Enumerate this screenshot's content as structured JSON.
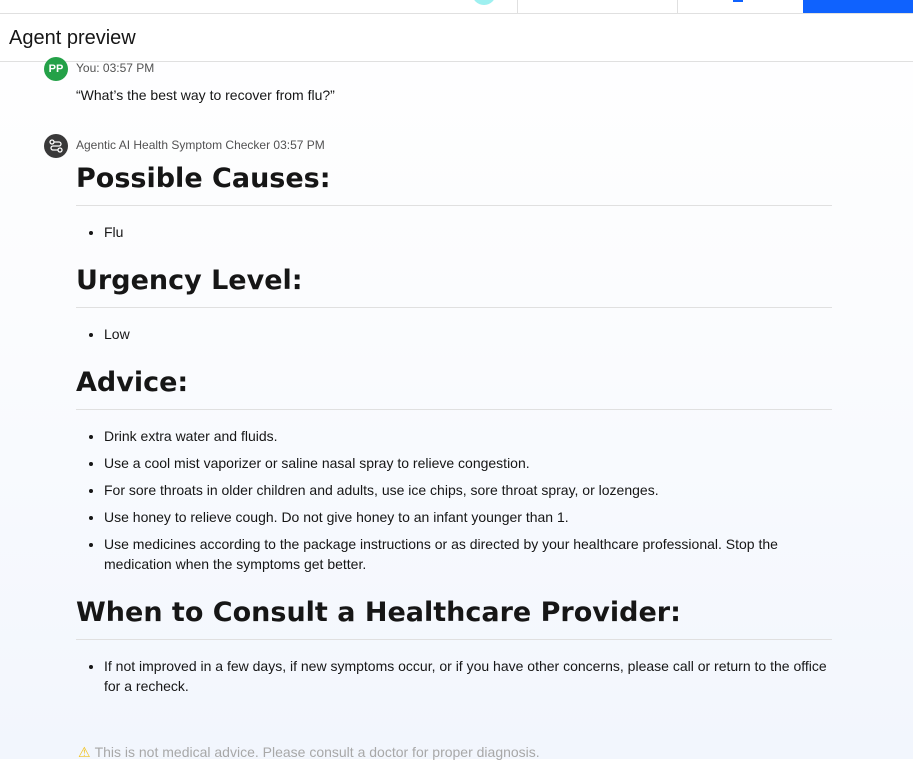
{
  "header": {
    "title": "Agent preview"
  },
  "conversation": {
    "user": {
      "initials": "PP",
      "meta": "You: 03:57 PM",
      "message": "“What’s the best way to recover from flu?”"
    },
    "agent": {
      "meta": "Agentic AI Health Symptom Checker 03:57 PM",
      "sections": [
        {
          "heading": "Possible Causes:",
          "items": [
            "Flu"
          ]
        },
        {
          "heading": "Urgency Level:",
          "items": [
            "Low"
          ]
        },
        {
          "heading": "Advice:",
          "items": [
            "Drink extra water and fluids.",
            "Use a cool mist vaporizer or saline nasal spray to relieve congestion.",
            "For sore throats in older children and adults, use ice chips, sore throat spray, or lozenges.",
            "Use honey to relieve cough. Do not give honey to an infant younger than 1.",
            "Use medicines according to the package instructions or as directed by your healthcare professional. Stop the medication when the symptoms get better."
          ]
        },
        {
          "heading": "When to Consult a Healthcare Provider:",
          "items": [
            "If not improved in a few days, if new symptoms occur, or if you have other concerns, please call or return to the office for a recheck."
          ]
        }
      ],
      "disclaimer": "This is not medical advice. Please consult a doctor for proper diagnosis."
    }
  },
  "icons": {
    "bot_avatar": "agent-flow-icon",
    "warning": "warning-icon"
  },
  "colors": {
    "accent": "#0f62fe",
    "user_avatar": "#24a148",
    "bot_avatar": "#393939"
  }
}
